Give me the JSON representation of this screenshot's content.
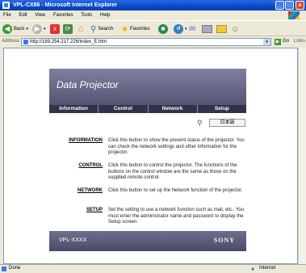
{
  "window": {
    "title": "VPL-CX86 - Microsoft Internet Explorer",
    "minimize": "_",
    "maximize": "□",
    "close": "x"
  },
  "menubar": {
    "items": [
      "File",
      "Edit",
      "View",
      "Favorites",
      "Tools",
      "Help"
    ]
  },
  "toolbar": {
    "back_label": "Back",
    "search_label": "Search",
    "favorites_label": "Favorites"
  },
  "address": {
    "label": "Address",
    "url": "http://169.254.217.226/index_E.htm",
    "go_label": "Go",
    "links_label": "Links"
  },
  "page": {
    "header_title": "Data Projector",
    "nav": [
      "Information",
      "Control",
      "Network",
      "Setup"
    ],
    "language_button": "日本語",
    "rows": [
      {
        "label": "INFORMATION",
        "description": "Click this button to show the present status of the projector. You can check the network settings and other information for the projector."
      },
      {
        "label": "CONTROL",
        "description": "Click this button to control the projector. The functions of the buttons on the control window are the same as those on the supplied remote control."
      },
      {
        "label": "NETWORK",
        "description": "Click this button to set up the Network function of the projector."
      },
      {
        "label": "SETUP",
        "description": "Set the setting to use a network function such as mail, etc.. You must enter the administrator name and password to display the Setup screen."
      }
    ],
    "footer_model": "VPL-XXXX",
    "footer_brand": "SONY"
  },
  "status": {
    "left": "Done",
    "zone": "Internet"
  },
  "colors": {
    "titlebar": "#0a47c8",
    "header_band": "#5a5a78",
    "nav_bg": "#32324a"
  }
}
